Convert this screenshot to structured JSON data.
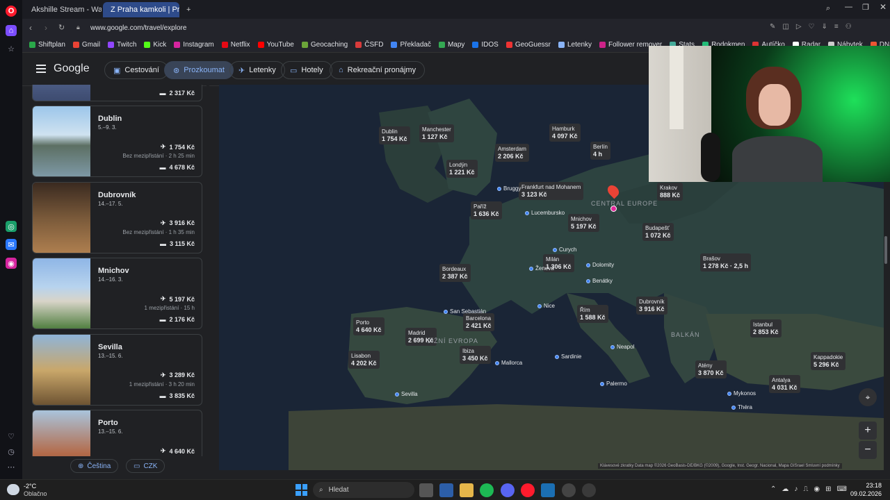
{
  "browser": {
    "tabs": [
      {
        "label": "Akshille Stream - Watch L"
      },
      {
        "label": "Z Praha kamkoli | Prozkou"
      }
    ],
    "url": "www.google.com/travel/explore",
    "bookmarks": [
      "Shiftplan",
      "Gmail",
      "Twitch",
      "Kick",
      "Instagram",
      "Netflix",
      "YouTube",
      "Geocaching",
      "ČSFD",
      "Překladač",
      "Mapy",
      "IDOS",
      "GeoGuessr",
      "Letenky",
      "Follower remover",
      "Stats",
      "Rodokmen",
      "Autíčko",
      "Radar",
      "Nábytek",
      "DNA results - Klose",
      "Postel"
    ]
  },
  "header": {
    "logo": "Google",
    "nav": [
      {
        "label": "Cestování"
      },
      {
        "label": "Prozkoumat"
      },
      {
        "label": "Letenky"
      },
      {
        "label": "Hotely"
      },
      {
        "label": "Rekreační pronájmy"
      }
    ]
  },
  "list": {
    "top_partial_hotel": "2 317 Kč",
    "cards": [
      {
        "name": "Dublin",
        "dates": "5.–9. 3.",
        "flight": "1 754 Kč",
        "info": "Bez mezipřistání · 2 h 25 min",
        "hotel": "4 678 Kč"
      },
      {
        "name": "Dubrovník",
        "dates": "14.–17. 5.",
        "flight": "3 916 Kč",
        "info": "Bez mezipřistání · 1 h 35 min",
        "hotel": "3 115 Kč"
      },
      {
        "name": "Mnichov",
        "dates": "14.–16. 3.",
        "flight": "5 197 Kč",
        "info": "1 mezipřistání · 15 h",
        "hotel": "2 176 Kč"
      },
      {
        "name": "Sevilla",
        "dates": "13.–15. 6.",
        "flight": "3 289 Kč",
        "info": "1 mezipřistání · 3 h 20 min",
        "hotel": "3 835 Kč"
      },
      {
        "name": "Porto",
        "dates": "13.–15. 6.",
        "flight": "4 640 Kč",
        "info": "",
        "hotel": ""
      }
    ]
  },
  "footer": {
    "language": "Čeština",
    "currency": "CZK"
  },
  "map": {
    "price_labels": [
      {
        "city": "Dublin",
        "price": "1 754 Kč"
      },
      {
        "city": "Manchester",
        "price": "1 127 Kč"
      },
      {
        "city": "Londýn",
        "price": "1 221 Kč"
      },
      {
        "city": "Amsterdam",
        "price": "2 206 Kč"
      },
      {
        "city": "Hamburk",
        "price": "4 097 Kč"
      },
      {
        "city": "Berlín",
        "price": "4 h"
      },
      {
        "city": "Frankfurt nad Mohanem",
        "price": "3 123 Kč"
      },
      {
        "city": "Paříž",
        "price": "1 636 Kč"
      },
      {
        "city": "Mnichov",
        "price": "5 197 Kč"
      },
      {
        "city": "Krakov",
        "price": "888 Kč"
      },
      {
        "city": "Budapešť",
        "price": "1 072 Kč"
      },
      {
        "city": "Brašov",
        "price": "1 278 Kč · 2,5 h"
      },
      {
        "city": "Milán",
        "price": "1 306 Kč"
      },
      {
        "city": "Bordeaux",
        "price": "2 387 Kč"
      },
      {
        "city": "Řím",
        "price": "1 588 Kč"
      },
      {
        "city": "Dubrovník",
        "price": "3 916 Kč"
      },
      {
        "city": "Barcelona",
        "price": "2 421 Kč"
      },
      {
        "city": "Porto",
        "price": "4 640 Kč"
      },
      {
        "city": "Madrid",
        "price": "2 699 Kč"
      },
      {
        "city": "Ibiza",
        "price": "3 450 Kč"
      },
      {
        "city": "Lisabon",
        "price": "4 202 Kč"
      },
      {
        "city": "Istanbul",
        "price": "2 853 Kč"
      },
      {
        "city": "Kappadokie",
        "price": "5 296 Kč"
      },
      {
        "city": "Atény",
        "price": "3 870 Kč"
      },
      {
        "city": "Antalya",
        "price": "4 031 Kč"
      }
    ],
    "places": [
      "Bruggy",
      "Lucembursko",
      "Curych",
      "Ženeva",
      "Dolomity",
      "Benátky",
      "Nice",
      "San Sebastián",
      "Mallorca",
      "Sardinie",
      "Neapol",
      "Palermo",
      "Sevilla",
      "Mykonos",
      "Théra"
    ],
    "regions": [
      "CENTRAL EUROPE",
      "BALKÁN",
      "JIŽNÍ EVROPA"
    ],
    "attribution": "Klávesové zkratky   Data map ©2026 GeoBasis-DE/BKG (©2009), Google, Inst. Geogr. Nacional, Mapa GISrael   Smluvní podmínky"
  },
  "taskbar": {
    "weather_temp": "-2°C",
    "weather_desc": "Oblačno",
    "search": "Hledat",
    "time": "23:18",
    "date": "09.02.2026"
  }
}
